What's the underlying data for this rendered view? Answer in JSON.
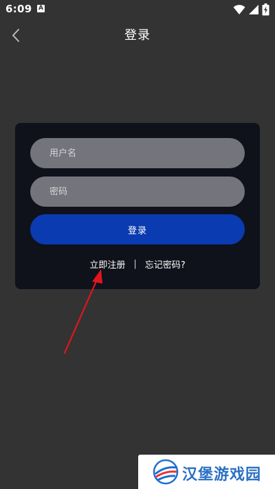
{
  "status_bar": {
    "time": "6:09",
    "notification_icon": "a-letter-icon",
    "icons": [
      "wifi-icon",
      "signal-icon",
      "battery-charging-icon"
    ]
  },
  "header": {
    "back_icon": "chevron-left-icon",
    "title": "登录"
  },
  "login_form": {
    "username_placeholder": "用户名",
    "password_placeholder": "密码",
    "submit_label": "登录",
    "register_link": "立即注册",
    "separator": "|",
    "forgot_link": "忘记密码?"
  },
  "annotation": {
    "arrow_color": "#e0161e"
  },
  "watermark": {
    "logo": "site-logo",
    "text": "汉堡游戏园"
  },
  "colors": {
    "background": "#333333",
    "card": "#0f111b",
    "field": "#74757c",
    "primary_button": "#0a3bb0"
  }
}
